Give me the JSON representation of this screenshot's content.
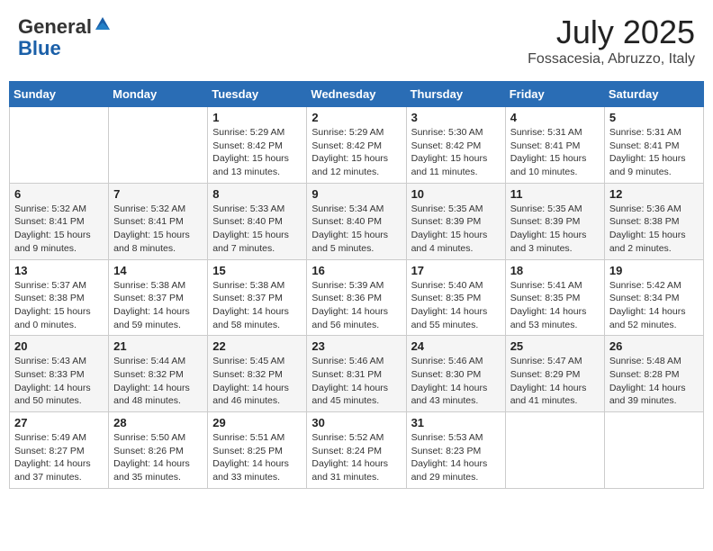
{
  "header": {
    "logo_general": "General",
    "logo_blue": "Blue",
    "month": "July 2025",
    "location": "Fossacesia, Abruzzo, Italy"
  },
  "days_of_week": [
    "Sunday",
    "Monday",
    "Tuesday",
    "Wednesday",
    "Thursday",
    "Friday",
    "Saturday"
  ],
  "weeks": [
    [
      {
        "day": "",
        "info": ""
      },
      {
        "day": "",
        "info": ""
      },
      {
        "day": "1",
        "info": "Sunrise: 5:29 AM\nSunset: 8:42 PM\nDaylight: 15 hours and 13 minutes."
      },
      {
        "day": "2",
        "info": "Sunrise: 5:29 AM\nSunset: 8:42 PM\nDaylight: 15 hours and 12 minutes."
      },
      {
        "day": "3",
        "info": "Sunrise: 5:30 AM\nSunset: 8:42 PM\nDaylight: 15 hours and 11 minutes."
      },
      {
        "day": "4",
        "info": "Sunrise: 5:31 AM\nSunset: 8:41 PM\nDaylight: 15 hours and 10 minutes."
      },
      {
        "day": "5",
        "info": "Sunrise: 5:31 AM\nSunset: 8:41 PM\nDaylight: 15 hours and 9 minutes."
      }
    ],
    [
      {
        "day": "6",
        "info": "Sunrise: 5:32 AM\nSunset: 8:41 PM\nDaylight: 15 hours and 9 minutes."
      },
      {
        "day": "7",
        "info": "Sunrise: 5:32 AM\nSunset: 8:41 PM\nDaylight: 15 hours and 8 minutes."
      },
      {
        "day": "8",
        "info": "Sunrise: 5:33 AM\nSunset: 8:40 PM\nDaylight: 15 hours and 7 minutes."
      },
      {
        "day": "9",
        "info": "Sunrise: 5:34 AM\nSunset: 8:40 PM\nDaylight: 15 hours and 5 minutes."
      },
      {
        "day": "10",
        "info": "Sunrise: 5:35 AM\nSunset: 8:39 PM\nDaylight: 15 hours and 4 minutes."
      },
      {
        "day": "11",
        "info": "Sunrise: 5:35 AM\nSunset: 8:39 PM\nDaylight: 15 hours and 3 minutes."
      },
      {
        "day": "12",
        "info": "Sunrise: 5:36 AM\nSunset: 8:38 PM\nDaylight: 15 hours and 2 minutes."
      }
    ],
    [
      {
        "day": "13",
        "info": "Sunrise: 5:37 AM\nSunset: 8:38 PM\nDaylight: 15 hours and 0 minutes."
      },
      {
        "day": "14",
        "info": "Sunrise: 5:38 AM\nSunset: 8:37 PM\nDaylight: 14 hours and 59 minutes."
      },
      {
        "day": "15",
        "info": "Sunrise: 5:38 AM\nSunset: 8:37 PM\nDaylight: 14 hours and 58 minutes."
      },
      {
        "day": "16",
        "info": "Sunrise: 5:39 AM\nSunset: 8:36 PM\nDaylight: 14 hours and 56 minutes."
      },
      {
        "day": "17",
        "info": "Sunrise: 5:40 AM\nSunset: 8:35 PM\nDaylight: 14 hours and 55 minutes."
      },
      {
        "day": "18",
        "info": "Sunrise: 5:41 AM\nSunset: 8:35 PM\nDaylight: 14 hours and 53 minutes."
      },
      {
        "day": "19",
        "info": "Sunrise: 5:42 AM\nSunset: 8:34 PM\nDaylight: 14 hours and 52 minutes."
      }
    ],
    [
      {
        "day": "20",
        "info": "Sunrise: 5:43 AM\nSunset: 8:33 PM\nDaylight: 14 hours and 50 minutes."
      },
      {
        "day": "21",
        "info": "Sunrise: 5:44 AM\nSunset: 8:32 PM\nDaylight: 14 hours and 48 minutes."
      },
      {
        "day": "22",
        "info": "Sunrise: 5:45 AM\nSunset: 8:32 PM\nDaylight: 14 hours and 46 minutes."
      },
      {
        "day": "23",
        "info": "Sunrise: 5:46 AM\nSunset: 8:31 PM\nDaylight: 14 hours and 45 minutes."
      },
      {
        "day": "24",
        "info": "Sunrise: 5:46 AM\nSunset: 8:30 PM\nDaylight: 14 hours and 43 minutes."
      },
      {
        "day": "25",
        "info": "Sunrise: 5:47 AM\nSunset: 8:29 PM\nDaylight: 14 hours and 41 minutes."
      },
      {
        "day": "26",
        "info": "Sunrise: 5:48 AM\nSunset: 8:28 PM\nDaylight: 14 hours and 39 minutes."
      }
    ],
    [
      {
        "day": "27",
        "info": "Sunrise: 5:49 AM\nSunset: 8:27 PM\nDaylight: 14 hours and 37 minutes."
      },
      {
        "day": "28",
        "info": "Sunrise: 5:50 AM\nSunset: 8:26 PM\nDaylight: 14 hours and 35 minutes."
      },
      {
        "day": "29",
        "info": "Sunrise: 5:51 AM\nSunset: 8:25 PM\nDaylight: 14 hours and 33 minutes."
      },
      {
        "day": "30",
        "info": "Sunrise: 5:52 AM\nSunset: 8:24 PM\nDaylight: 14 hours and 31 minutes."
      },
      {
        "day": "31",
        "info": "Sunrise: 5:53 AM\nSunset: 8:23 PM\nDaylight: 14 hours and 29 minutes."
      },
      {
        "day": "",
        "info": ""
      },
      {
        "day": "",
        "info": ""
      }
    ]
  ]
}
